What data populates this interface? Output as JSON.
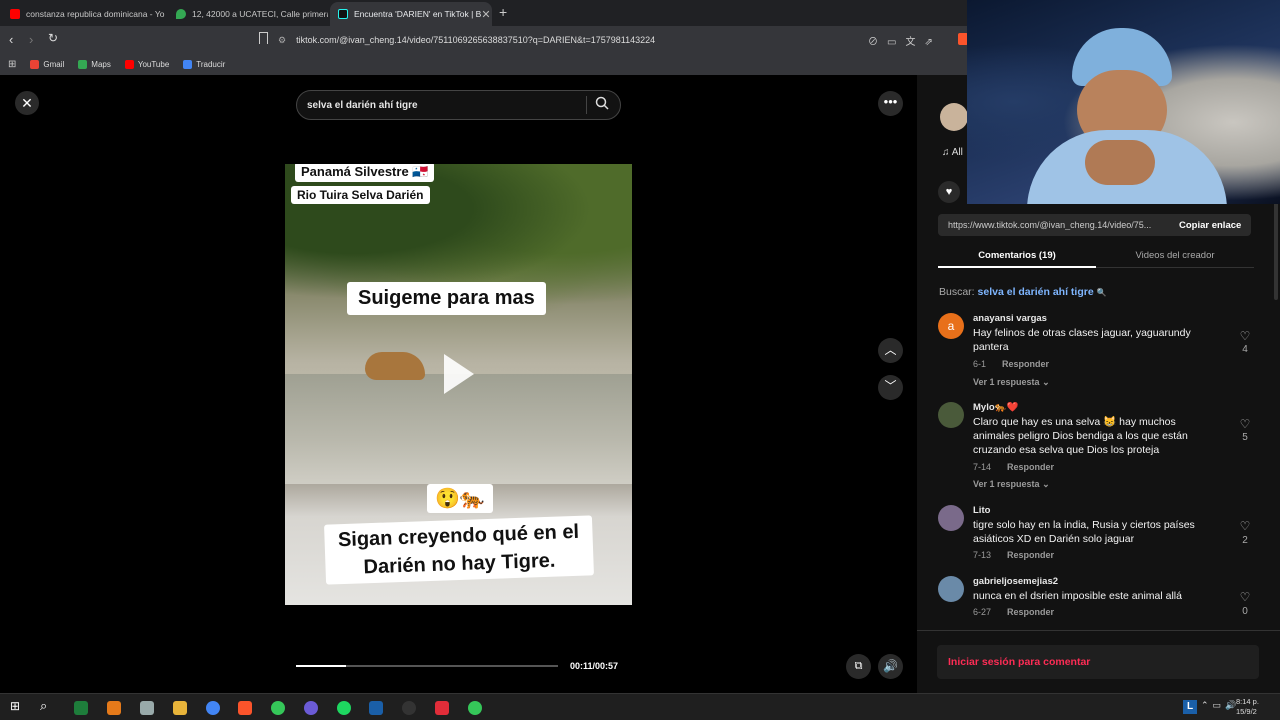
{
  "tabs": [
    {
      "label": "constanza republica dominicana - Yo",
      "color": "#ff0000"
    },
    {
      "label": "12, 42000 a UCATECI, Calle primera, ",
      "color": "#34a853"
    },
    {
      "label": "Encuentra 'DARIEN' en TikTok | B",
      "color": "#111111"
    }
  ],
  "new_tab": "+",
  "url": "tiktok.com/@ivan_cheng.14/video/7511069265638837510?q=DARIEN&t=1757981143224",
  "bookmarks": [
    {
      "label": "Gmail",
      "color": "#ea4335"
    },
    {
      "label": "Maps",
      "color": "#34a853"
    },
    {
      "label": "YouTube",
      "color": "#ff0000"
    },
    {
      "label": "Traducir",
      "color": "#4285f4"
    }
  ],
  "search": {
    "value": "selva el darién ahí tigre"
  },
  "video": {
    "caption1": "Panamá Silvestre 🇵🇦",
    "caption2": "Rio Tuira  Selva Darién",
    "caption3": "Suigeme para mas",
    "emoji": "😲🐅",
    "caption4": "Sigan creyendo  qué en el Darién no hay Tigre.",
    "time": "00:11/00:57",
    "progress": 0.19
  },
  "right": {
    "music_label": "All",
    "link": "https://www.tiktok.com/@ivan_cheng.14/video/75...",
    "copy_label": "Copiar enlace",
    "tab_comments": "Comentarios (19)",
    "tab_videos": "Videos del creador",
    "search_prefix": "Buscar:",
    "search_term": "selva el darién ahí tigre",
    "login": "Iniciar sesión para comentar"
  },
  "comments": [
    {
      "name": "anayansi vargas",
      "text": "Hay felinos de otras clases jaguar, yaguarundy pantera",
      "date": "6-1",
      "reply": "Responder",
      "more": "Ver 1 respuesta",
      "likes": "4",
      "avatar_letter": "a",
      "avatar_color": "#e8701a"
    },
    {
      "name": "Mylo🐅❤️",
      "text": "Claro que hay es una selva 😸 hay muchos animales peligro Dios bendiga a los que están cruzando esa selva que Dios los proteja",
      "date": "7-14",
      "reply": "Responder",
      "more": "Ver 1 respuesta",
      "likes": "5",
      "avatar_letter": "",
      "avatar_color": "#4a5a3a"
    },
    {
      "name": "Lito",
      "text": "tigre solo hay en la india, Rusia y ciertos países asiáticos XD en Darién solo jaguar",
      "date": "7-13",
      "reply": "Responder",
      "more": "",
      "likes": "2",
      "avatar_letter": "",
      "avatar_color": "#7a6a8a"
    },
    {
      "name": "gabrieljosemejias2",
      "text": "nunca en el dsrien imposible este animal allá",
      "date": "6-27",
      "reply": "Responder",
      "more": "",
      "likes": "0",
      "avatar_letter": "",
      "avatar_color": "#6a8aa8"
    }
  ],
  "clock": {
    "time": "8:14 p.",
    "date": "15/9/2"
  },
  "lang": "L"
}
